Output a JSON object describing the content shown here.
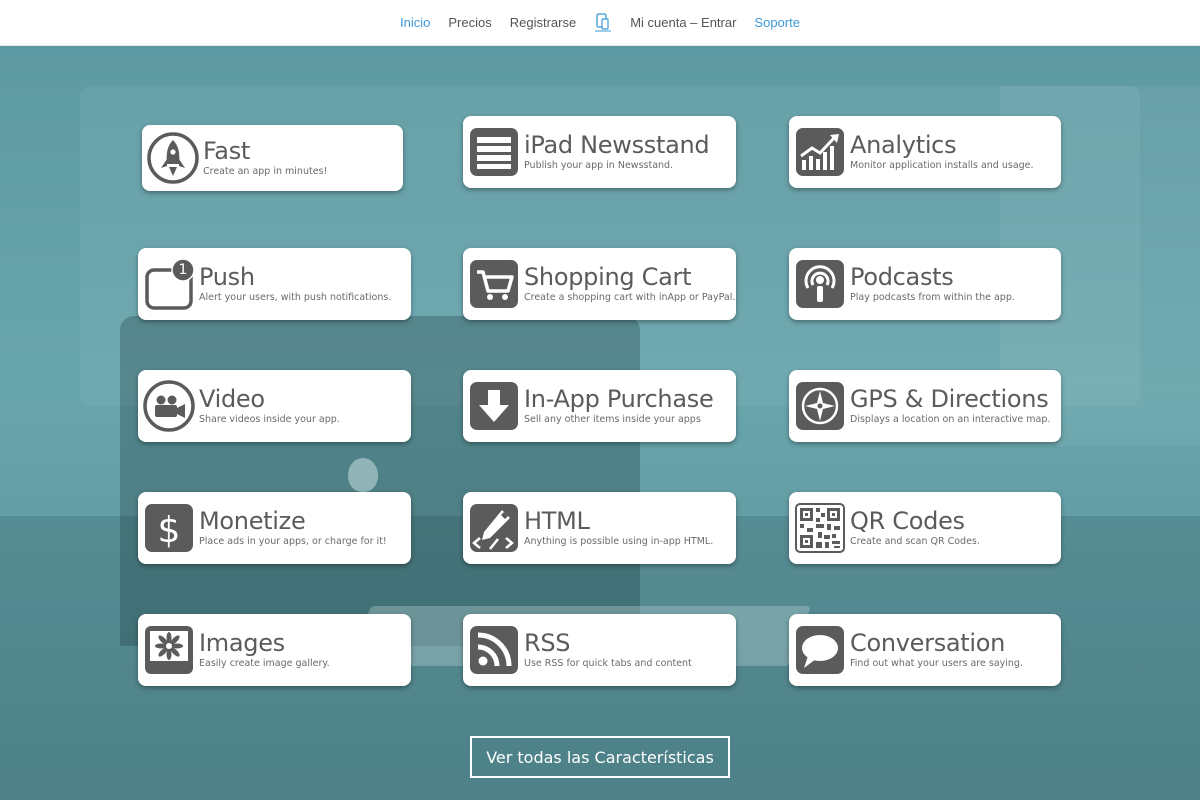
{
  "nav": {
    "items": [
      {
        "label": "Inicio",
        "state": "active"
      },
      {
        "label": "Precios",
        "state": "normal"
      },
      {
        "label": "Registrarse",
        "state": "normal"
      },
      {
        "label": "Mi cuenta – Entrar",
        "state": "normal"
      },
      {
        "label": "Soporte",
        "state": "accent"
      }
    ],
    "device_icon": "tablet-phone-icon"
  },
  "features": [
    {
      "title": "Fast",
      "desc": "Create an app in minutes!",
      "icon": "rocket-icon"
    },
    {
      "title": "iPad Newsstand",
      "desc": "Publish your app in Newsstand.",
      "icon": "newsstand-icon"
    },
    {
      "title": "Analytics",
      "desc": "Monitor application installs and usage.",
      "icon": "analytics-icon"
    },
    {
      "title": "Push",
      "desc": "Alert your users, with push notifications.",
      "icon": "push-badge-icon",
      "badge": "1"
    },
    {
      "title": "Shopping Cart",
      "desc": "Create a shopping cart with inApp or PayPal.",
      "icon": "shopping-cart-icon"
    },
    {
      "title": "Podcasts",
      "desc": "Play podcasts from within the app.",
      "icon": "podcast-icon"
    },
    {
      "title": "Video",
      "desc": "Share videos inside your app.",
      "icon": "video-camera-icon"
    },
    {
      "title": "In-App Purchase",
      "desc": "Sell any other items inside your apps",
      "icon": "download-arrow-icon"
    },
    {
      "title": "GPS & Directions",
      "desc": "Displays a location on an interactive map.",
      "icon": "compass-icon"
    },
    {
      "title": "Monetize",
      "desc": "Place ads in your apps, or charge for it!",
      "icon": "dollar-icon"
    },
    {
      "title": "HTML",
      "desc": "Anything is possible using in-app HTML.",
      "icon": "html-pencil-icon"
    },
    {
      "title": "QR Codes",
      "desc": "Create and scan QR Codes.",
      "icon": "qr-code-icon"
    },
    {
      "title": "Images",
      "desc": "Easily create image gallery.",
      "icon": "image-gallery-icon"
    },
    {
      "title": "RSS",
      "desc": "Use RSS for quick tabs and content",
      "icon": "rss-icon"
    },
    {
      "title": "Conversation",
      "desc": "Find out what your users are saying.",
      "icon": "chat-bubble-icon"
    }
  ],
  "cta": {
    "label": "Ver todas las Características"
  },
  "colors": {
    "accent": "#3d9ad8",
    "icon_gray": "#5b5b5b",
    "hero_tint": "#4f9aa0"
  }
}
